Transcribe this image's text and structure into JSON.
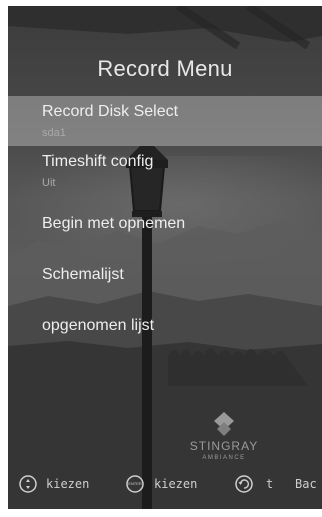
{
  "title": "Record Menu",
  "menu": {
    "items": [
      {
        "label": "Record Disk Select",
        "value": "sda1",
        "selected": true
      },
      {
        "label": "Timeshift config",
        "value": "Uit",
        "selected": false
      },
      {
        "label": "Begin met opnemen",
        "selected": false
      },
      {
        "label": "Schemalijst",
        "selected": false
      },
      {
        "label": "opgenomen lijst",
        "selected": false
      }
    ]
  },
  "logo": {
    "brand": "STINGRAY",
    "tagline": "AMBIANCE"
  },
  "footer": {
    "hints": [
      {
        "icon": "dpad-circle-icon",
        "label": "kiezen"
      },
      {
        "icon": "enter-button-icon",
        "badge": "ENTER",
        "label": "kiezen"
      },
      {
        "icon": "back-arrow-icon",
        "label": "t"
      },
      {
        "label": "Bac"
      }
    ]
  }
}
